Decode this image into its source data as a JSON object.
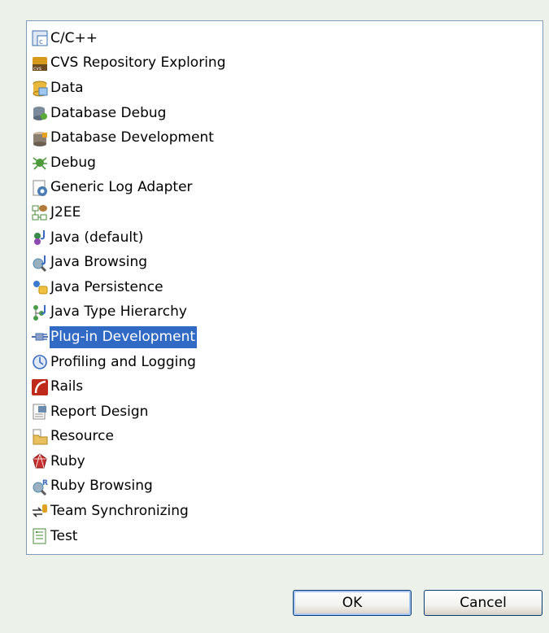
{
  "perspectives": [
    {
      "label": "C/C++",
      "icon": "cpp-icon",
      "color": "#3a6fb0"
    },
    {
      "label": "CVS Repository Exploring",
      "icon": "cvs-icon",
      "color": "#d59a1b"
    },
    {
      "label": "Data",
      "icon": "data-icon",
      "color": "#e8b93c"
    },
    {
      "label": "Database Debug",
      "icon": "database-debug-icon",
      "color": "#7a8a9a"
    },
    {
      "label": "Database Development",
      "icon": "database-development-icon",
      "color": "#8a7f70"
    },
    {
      "label": "Debug",
      "icon": "debug-icon",
      "color": "#4e9a3a"
    },
    {
      "label": "Generic Log Adapter",
      "icon": "log-adapter-icon",
      "color": "#4a7db5"
    },
    {
      "label": "J2EE",
      "icon": "j2ee-icon",
      "color": "#b07a3a"
    },
    {
      "label": "Java (default)",
      "icon": "java-icon",
      "color": "#5a8a3a"
    },
    {
      "label": "Java Browsing",
      "icon": "java-browsing-icon",
      "color": "#4a8ab0"
    },
    {
      "label": "Java Persistence",
      "icon": "java-persistence-icon",
      "color": "#3a7ad0"
    },
    {
      "label": "Java Type Hierarchy",
      "icon": "java-type-hierarchy-icon",
      "color": "#4a9a4a"
    },
    {
      "label": "Plug-in Development",
      "icon": "plugin-icon",
      "color": "#4a6fb0"
    },
    {
      "label": "Profiling and Logging",
      "icon": "profiling-icon",
      "color": "#3a6ac0"
    },
    {
      "label": "Rails",
      "icon": "rails-icon",
      "color": "#c02a1a"
    },
    {
      "label": "Report Design",
      "icon": "report-design-icon",
      "color": "#6a8ab0"
    },
    {
      "label": "Resource",
      "icon": "resource-icon",
      "color": "#e8c060"
    },
    {
      "label": "Ruby",
      "icon": "ruby-icon",
      "color": "#c83030"
    },
    {
      "label": "Ruby Browsing",
      "icon": "ruby-browsing-icon",
      "color": "#4a8ab0"
    },
    {
      "label": "Team Synchronizing",
      "icon": "team-sync-icon",
      "color": "#e0a020"
    },
    {
      "label": "Test",
      "icon": "test-icon",
      "color": "#4a8a3a"
    }
  ],
  "selected_label": "Plug-in Development",
  "buttons": {
    "ok": "OK",
    "cancel": "Cancel"
  },
  "colors": {
    "selection": "#316ac5",
    "dialog_bg": "#ecf1e9",
    "list_border": "#7f9db9"
  }
}
